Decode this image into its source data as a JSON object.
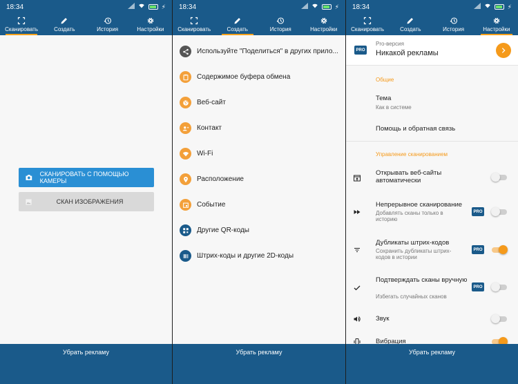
{
  "status": {
    "time": "18:34"
  },
  "tabs": [
    {
      "label": "Сканировать",
      "icon": "scan-icon"
    },
    {
      "label": "Создать",
      "icon": "pencil-icon"
    },
    {
      "label": "История",
      "icon": "history-icon"
    },
    {
      "label": "Настройки",
      "icon": "gear-icon"
    }
  ],
  "remove_ads": "Убрать рекламу",
  "scan": {
    "camera_button": "СКАНИРОВАТЬ С ПОМОЩЬЮ КАМЕРЫ",
    "image_button": "СКАН ИЗОБРАЖЕНИЯ"
  },
  "create": {
    "items": [
      {
        "label": "Используйте \"Поделиться\" в других прило...",
        "icon": "share-icon",
        "color": "#555555"
      },
      {
        "label": "Содержимое буфера обмена",
        "icon": "clipboard-icon",
        "color": "#f3a03a"
      },
      {
        "label": "Веб-сайт",
        "icon": "globe-icon",
        "color": "#f3a03a"
      },
      {
        "label": "Контакт",
        "icon": "contact-icon",
        "color": "#f3a03a"
      },
      {
        "label": "Wi-Fi",
        "icon": "wifi-icon",
        "color": "#f3a03a"
      },
      {
        "label": "Расположение",
        "icon": "location-icon",
        "color": "#f3a03a"
      },
      {
        "label": "Событие",
        "icon": "event-icon",
        "color": "#f3a03a"
      },
      {
        "label": "Другие QR-коды",
        "icon": "qr-icon",
        "color": "#1a5a8a"
      },
      {
        "label": "Штрих-коды и другие 2D-коды",
        "icon": "barcode-icon",
        "color": "#1a5a8a"
      }
    ]
  },
  "settings": {
    "pro_badge": "PRO",
    "pro_small": "Pro-версия",
    "pro_title": "Никакой рекламы",
    "section_general": "Общие",
    "theme_title": "Тема",
    "theme_sub": "Как в системе",
    "help": "Помощь и обратная связь",
    "section_scan": "Управление сканированием",
    "items": [
      {
        "title": "Открывать веб-сайты автоматически",
        "sub": "",
        "pro": false,
        "on": false
      },
      {
        "title": "Непрерывное сканирование",
        "sub": "Добавлять сканы только в историю",
        "pro": true,
        "on": false
      },
      {
        "title": "Дубликаты штрих-кодов",
        "sub": "Сохранить дубликаты штрих-кодов в истории",
        "pro": true,
        "on": true
      },
      {
        "title": "Подтверждать сканы вручную",
        "sub": "Избегать случайных сканов",
        "pro": true,
        "on": false
      },
      {
        "title": "Звук",
        "sub": "",
        "pro": false,
        "on": false
      },
      {
        "title": "Вибрация",
        "sub": "",
        "pro": false,
        "on": true
      }
    ]
  },
  "colors": {
    "primary": "#1a5a8a",
    "accent": "#f59a1b",
    "camera_button": "#2a8fd4"
  }
}
